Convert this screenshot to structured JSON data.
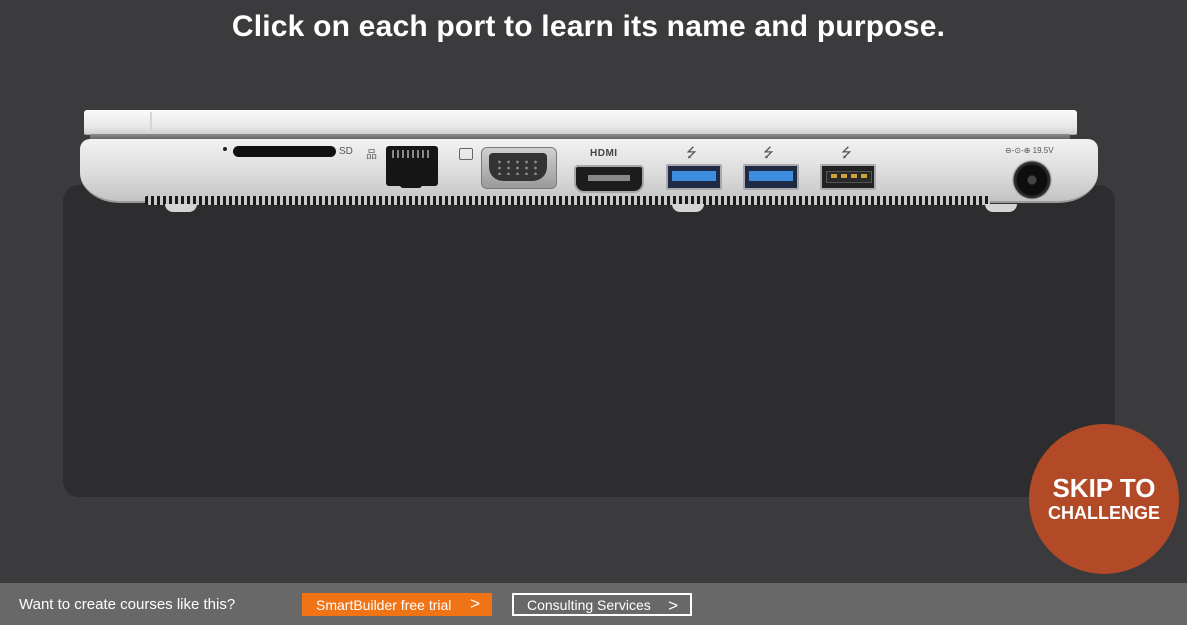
{
  "header": {
    "instruction": "Click on each port to learn its name and purpose."
  },
  "laptop": {
    "labels": {
      "sd": "SD",
      "hdmi": "HDMI",
      "dc": "⊖-⊙-⊕ 19.5V",
      "usb_symbol": "⭍",
      "ethernet_symbol": "品"
    },
    "ports": [
      "sd-card-slot",
      "ethernet-port",
      "vga-port",
      "hdmi-port",
      "usb-3-port",
      "usb-3-port",
      "usb-2-port",
      "dc-power-jack"
    ],
    "colors": {
      "usb3": "#3d8de0",
      "panel": "#2d2d2f",
      "background": "#3b3b3d"
    }
  },
  "skip": {
    "line1": "SKIP TO",
    "line2": "CHALLENGE",
    "color": "#b34a27"
  },
  "footer": {
    "prompt": "Want to create courses like this?",
    "trial_label": "SmartBuilder free trial",
    "consult_label": "Consulting Services",
    "chevron": ">",
    "trial_color": "#f07316"
  }
}
